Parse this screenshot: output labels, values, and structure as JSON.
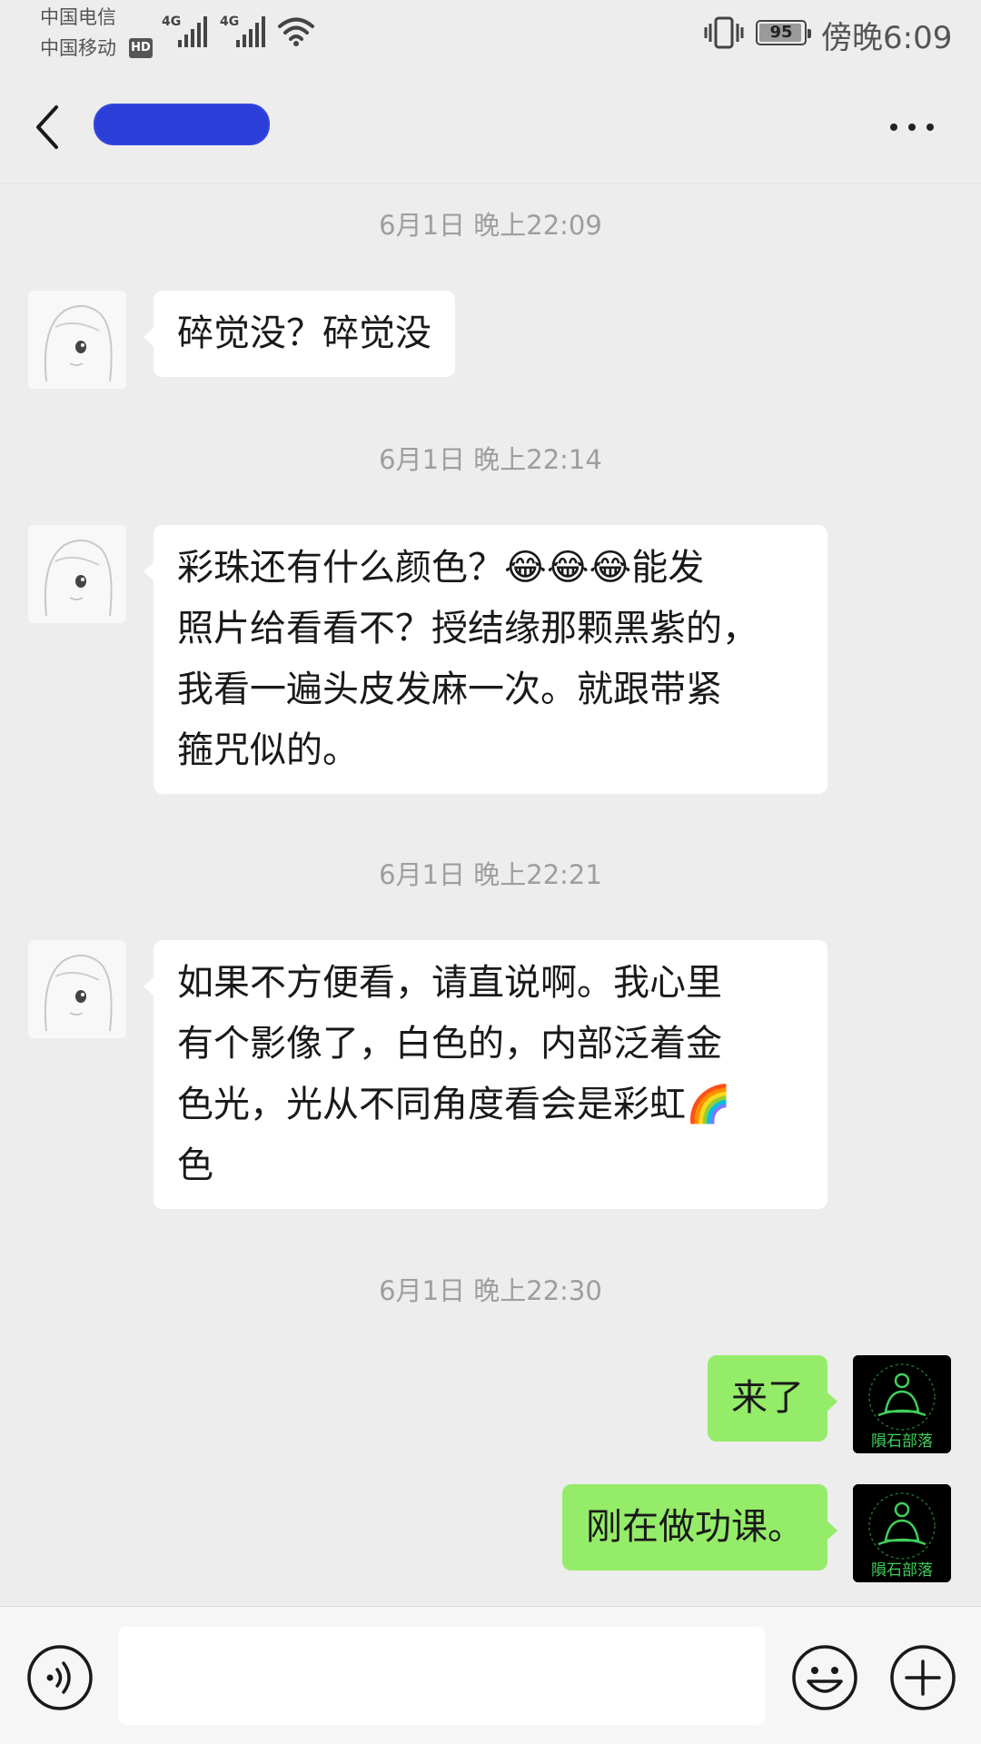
{
  "status_bar": {
    "carrier_1": "中国电信",
    "carrier_2": "中国移动",
    "hd_badge": "HD",
    "network_1": "4G",
    "network_2": "4G",
    "battery": "95",
    "time": "傍晚6:09"
  },
  "header": {
    "back_icon": "chevron-left-icon",
    "more_icon": "more-dots-icon"
  },
  "messages": [
    {
      "type": "timestamp",
      "text": "6月1日 晚上22:09"
    },
    {
      "type": "received",
      "text": "碎觉没？碎觉没"
    },
    {
      "type": "timestamp",
      "text": "6月1日 晚上22:14"
    },
    {
      "type": "received",
      "lines": [
        "彩珠还有什么颜色？😂😂😂能发",
        "照片给看看不？授结缘那颗黑紫的，",
        "我看一遍头皮发麻一次。就跟带紧",
        "箍咒似的。"
      ]
    },
    {
      "type": "timestamp",
      "text": "6月1日 晚上22:21"
    },
    {
      "type": "received",
      "lines": [
        "如果不方便看，请直说啊。我心里",
        "有个影像了，白色的，内部泛着金",
        "色光，光从不同角度看会是彩虹🌈",
        "色"
      ]
    },
    {
      "type": "timestamp",
      "text": "6月1日 晚上22:30"
    },
    {
      "type": "sent",
      "text": "来了"
    },
    {
      "type": "sent",
      "text": "刚在做功课。"
    }
  ],
  "self_avatar": {
    "caption": "隕石部落"
  },
  "input_bar": {
    "voice_icon": "voice-icon",
    "emoji_icon": "emoji-icon",
    "plus_icon": "plus-icon",
    "input_value": ""
  },
  "colors": {
    "background": "#ededed",
    "sent_bubble": "#95ec69",
    "received_bubble": "#ffffff",
    "name_redaction": "#2b3fd8"
  }
}
